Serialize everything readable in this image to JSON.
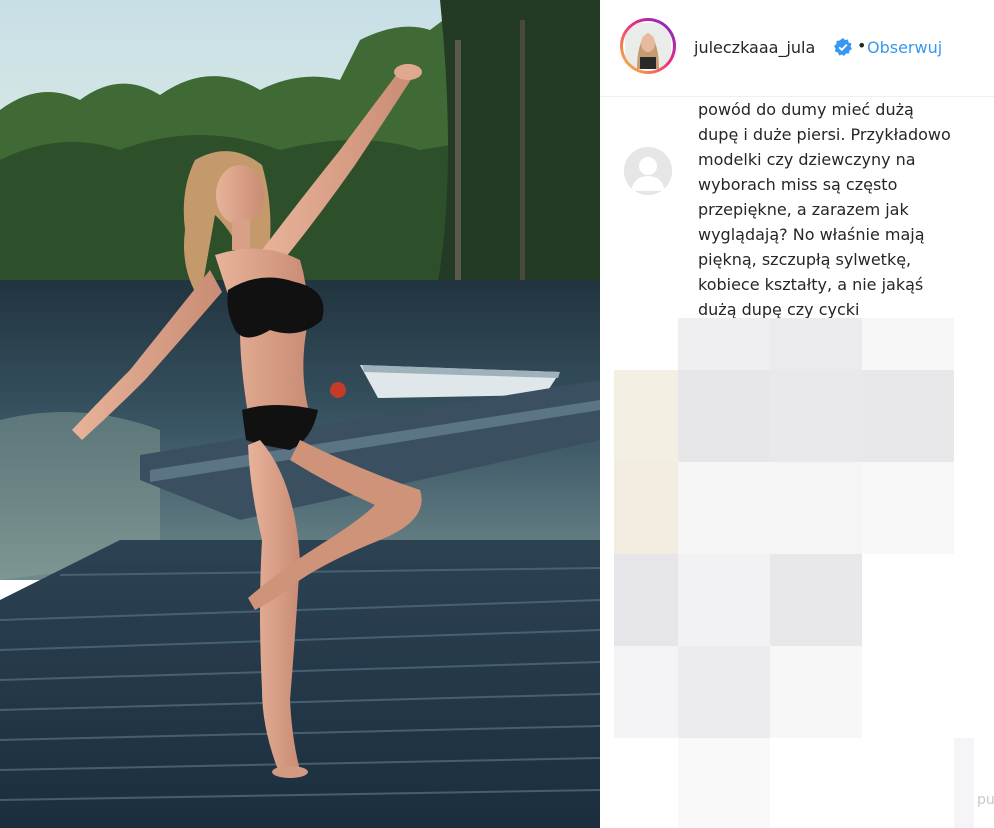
{
  "post": {
    "author": {
      "username": "juleczkaaa_jula",
      "verified": true,
      "separator": "•",
      "follow_label": "Obserwuj"
    },
    "comment": {
      "lines": [
        "powód do dumy mieć dużą",
        "dupę i duże piersi. Przykładowo",
        "modelki czy dziewczyny na",
        "wyborach miss są często",
        "przepiękne, a zarazem jak",
        "wyglądają? No właśnie mają",
        "piękną, szczupłą sylwetkę,",
        "kobiece kształty, a nie jakąś",
        "dużą dupę czy cycki"
      ]
    },
    "corner_text": "pu"
  },
  "colors": {
    "link_blue": "#3897f0",
    "text": "#262626",
    "verified_blue": "#3897f0",
    "mosaic_tints": [
      "#f3ede0",
      "#efeff1",
      "#e7e7ea",
      "#f7f7f8",
      "#e2e2e6"
    ]
  },
  "icons": {
    "verified": "verified-badge-icon",
    "comment_avatar": "default-avatar-icon"
  }
}
